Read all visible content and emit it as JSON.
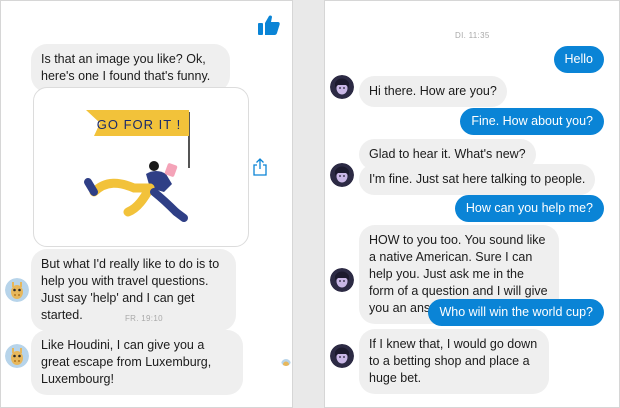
{
  "left_chat": {
    "messages": [
      {
        "text": "Is that an image you like? Ok, here's one I found that's funny."
      },
      {
        "image_caption": "GO FOR IT !"
      },
      {
        "text": "But what I'd really like to do is to help you with travel questions. Just say 'help' and I can get started."
      },
      {
        "text": "Like Houdini, I can give you a great escape from Luxemburg, Luxembourg!"
      }
    ],
    "timestamp": "FR. 19:10",
    "icons": {
      "like": "thumbs-up-icon",
      "share": "share-icon",
      "bot_avatar": "giraffe-avatar-icon"
    }
  },
  "right_chat": {
    "timestamp": "DI. 11:35",
    "messages": [
      {
        "from": "user",
        "text": "Hello"
      },
      {
        "from": "bot",
        "text": "Hi there. How are you?"
      },
      {
        "from": "user",
        "text": "Fine. How about you?"
      },
      {
        "from": "bot",
        "text": "Glad to hear it. What's new?"
      },
      {
        "from": "bot",
        "text": "I'm fine. Just sat here talking to people."
      },
      {
        "from": "user",
        "text": "How can you help me?"
      },
      {
        "from": "bot",
        "text": "HOW to you too. You sound like a native American. Sure I can help you. Just ask me in the form of a question and I will give you an answer."
      },
      {
        "from": "user",
        "text": "Who will win the world cup?"
      },
      {
        "from": "bot",
        "text": "If I knew that, I would go down to a betting shop and place a huge bet."
      }
    ],
    "icons": {
      "bot_avatar": "bot-avatar-icon"
    }
  },
  "colors": {
    "user_bubble": "#0a84d6",
    "bot_bubble": "#efefef",
    "like": "#0a84d6",
    "flag": "#f2c23a",
    "figure_pants": "#2f3f86"
  }
}
